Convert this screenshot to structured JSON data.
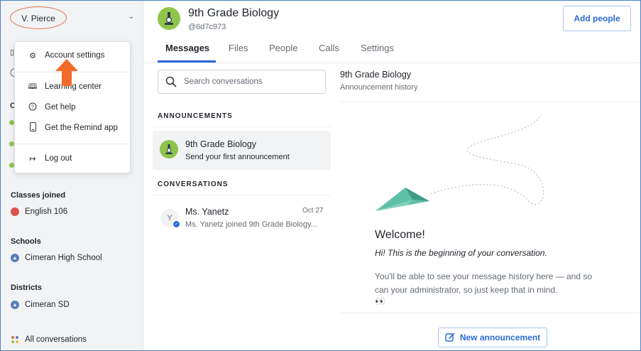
{
  "user": {
    "name": "V. Pierce"
  },
  "menu": {
    "items": [
      {
        "label": "Account settings",
        "icon": "gear-icon"
      },
      {
        "label": "Learning center",
        "icon": "book-icon"
      },
      {
        "label": "Get help",
        "icon": "help-circle-icon"
      },
      {
        "label": "Get the Remind app",
        "icon": "phone-icon"
      },
      {
        "label": "Log out",
        "icon": "logout-icon"
      }
    ]
  },
  "sidebar": {
    "classes_joined": {
      "heading": "Classes joined",
      "items": [
        {
          "label": "English 106"
        }
      ]
    },
    "schools": {
      "heading": "Schools",
      "items": [
        {
          "label": "Cimeran High School"
        }
      ]
    },
    "districts": {
      "heading": "Districts",
      "items": [
        {
          "label": "Cimeran SD"
        }
      ]
    },
    "all_conversations": {
      "label": "All conversations"
    }
  },
  "header": {
    "title": "9th Grade Biology",
    "code": "@6d7c973",
    "add_people_label": "Add people"
  },
  "tabs": [
    {
      "label": "Messages",
      "active": true
    },
    {
      "label": "Files"
    },
    {
      "label": "People"
    },
    {
      "label": "Calls"
    },
    {
      "label": "Settings"
    }
  ],
  "search": {
    "placeholder": "Search conversations"
  },
  "announcements": {
    "heading": "ANNOUNCEMENTS",
    "item": {
      "name": "9th Grade Biology",
      "subtitle": "Send your first announcement"
    }
  },
  "conversations": {
    "heading": "CONVERSATIONS",
    "items": [
      {
        "initial": "Y",
        "name": "Ms. Yanetz",
        "date": "Oct 27",
        "preview": "Ms. Yanetz joined 9th Grade Biology..."
      }
    ]
  },
  "pane": {
    "title": "9th Grade Biology",
    "subtitle": "Announcement history",
    "welcome": "Welcome!",
    "intro": "Hi! This is the beginning of your conversation.",
    "note": "You'll be able to see your message history here — and so can your administrator, so just keep that in mind.",
    "eyes": "👀",
    "new_announcement_label": "New announcement"
  },
  "colors": {
    "accent": "#2a6ad4",
    "class_avatar": "#8fc44a",
    "annotation": "#f26b2a"
  }
}
